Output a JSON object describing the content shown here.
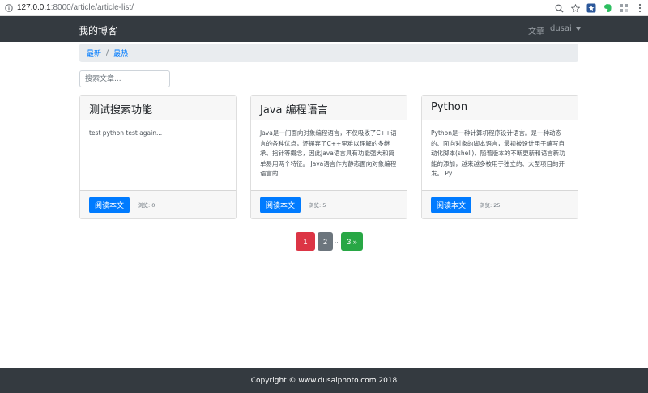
{
  "browser": {
    "url_host": "127.0.0.1",
    "url_path": ":8000/article/article-list/",
    "icons": [
      "info-icon",
      "zoom-icon",
      "star-icon",
      "extension-icon",
      "evernote-icon",
      "extension-grid-icon",
      "menu-icon"
    ]
  },
  "navbar": {
    "brand": "我的博客",
    "links": {
      "articles": "文章",
      "user": "dusai"
    }
  },
  "breadcrumb": {
    "items": [
      "最新",
      "最热"
    ],
    "separator": "/"
  },
  "search": {
    "placeholder": "搜索文章..."
  },
  "cards": [
    {
      "title": "测试搜索功能",
      "body": "test python test again...",
      "button": "阅读本文",
      "views": "浏览: 0"
    },
    {
      "title": "Java 编程语言",
      "body": "Java是一门面向对象编程语言，不仅吸收了C++语言的各种优点，还摒弃了C++里难以理解的多继承、指针等概念，因此Java语言具有功能强大和简单易用两个特征。 Java语言作为静态面向对象编程语言的...",
      "button": "阅读本文",
      "views": "浏览: 5"
    },
    {
      "title": "Python",
      "body": "Python是一种计算机程序设计语言。是一种动态的、面向对象的脚本语言，最初被设计用于编写自动化脚本(shell)，随着版本的不断更新和语言新功能的添加，越来越多被用于独立的、大型项目的开发。 Py...",
      "button": "阅读本文",
      "views": "浏览: 25"
    }
  ],
  "pagination": {
    "current": "1",
    "page2": "2",
    "ellipsis": "...",
    "last": "3 »"
  },
  "footer": {
    "copyright": "Copyright © www.dusaiphoto.com 2018"
  },
  "colors": {
    "navbar_bg": "#343a40",
    "primary": "#007bff",
    "danger": "#dc3545",
    "secondary": "#6c757d",
    "success": "#28a745"
  }
}
